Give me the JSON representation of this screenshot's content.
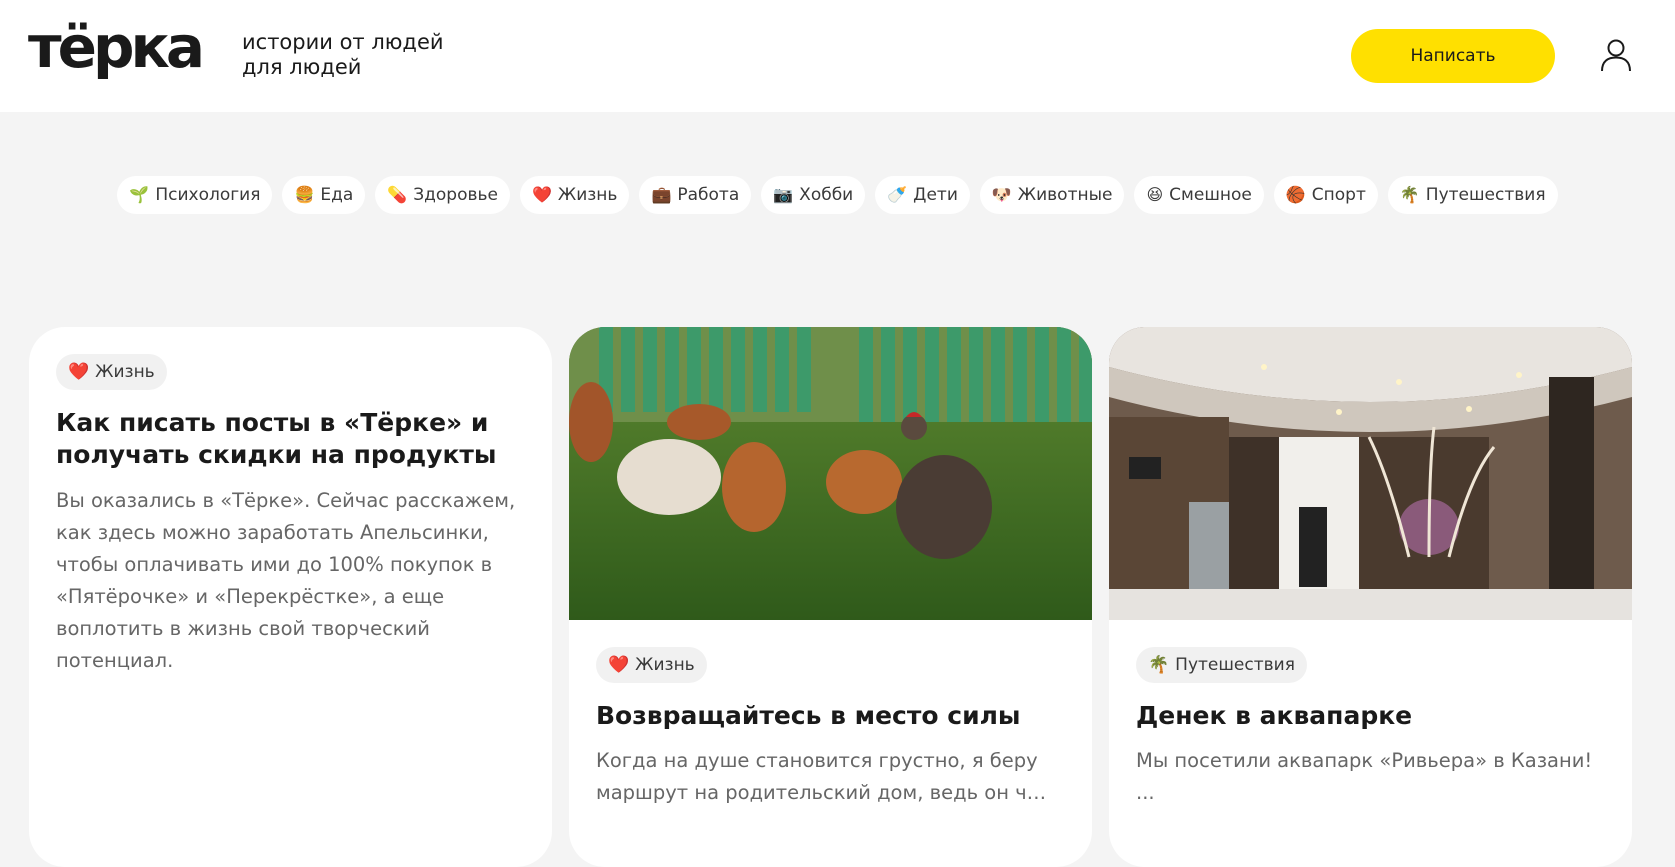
{
  "header": {
    "logo": "тёрка",
    "tagline_line1": "истории от людей",
    "tagline_line2": "для людей",
    "write_button": "Написать",
    "user_icon": "user-icon",
    "accent_color": "#ffe000"
  },
  "categories": [
    {
      "emoji": "🌱",
      "label": "Психология"
    },
    {
      "emoji": "🍔",
      "label": "Еда"
    },
    {
      "emoji": "💊",
      "label": "Здоровье"
    },
    {
      "emoji": "❤️",
      "label": "Жизнь"
    },
    {
      "emoji": "💼",
      "label": "Работа"
    },
    {
      "emoji": "📷",
      "label": "Хобби"
    },
    {
      "emoji": "🍼",
      "label": "Дети"
    },
    {
      "emoji": "🐶",
      "label": "Животные"
    },
    {
      "emoji": "😆",
      "label": "Смешное"
    },
    {
      "emoji": "🏀",
      "label": "Спорт"
    },
    {
      "emoji": "🌴",
      "label": "Путешествия"
    }
  ],
  "cards": [
    {
      "tag_emoji": "❤️",
      "tag": "Жизнь",
      "title": "Как писать посты в «Тёрке» и получать скидки на продукты",
      "desc": "Вы оказались в «Тёрке». Сейчас расскажем, как здесь можно заработать Апельсинки, чтобы оплачивать ими до 100% покупок в «Пятёрочке» и «Перекрёстке», а еще воплотить в жизнь свой творческий потенциал."
    },
    {
      "tag_emoji": "❤️",
      "tag": "Жизнь",
      "title": "Возвращайтесь в место силы",
      "desc_line1": "Когда на душе становится грустно, я беру",
      "desc_line2": "маршрут на родительский дом, ведь он част…",
      "image": "chickens-photo"
    },
    {
      "tag_emoji": "🌴",
      "tag": "Путешествия",
      "title": "Денек в аквапарке",
      "desc_line1": "Мы посетили аквапарк «Ривьера» в Казани!",
      "desc_line2": "...",
      "image": "hotel-lobby-photo"
    }
  ]
}
